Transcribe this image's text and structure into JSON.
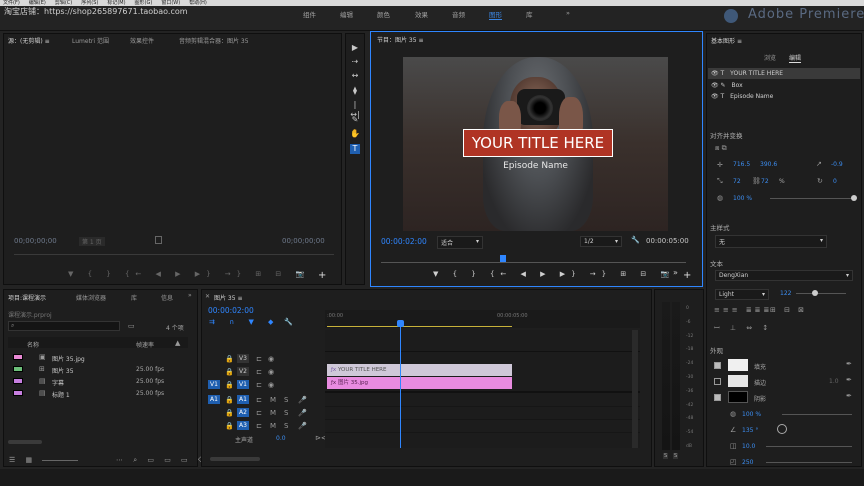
{
  "menu": [
    "文件(F)",
    "编辑(E)",
    "剪辑(C)",
    "序列(S)",
    "标记(M)",
    "图形(G)",
    "窗口(W)",
    "帮助(H)"
  ],
  "shop_label": "淘宝店铺：https://shop265897671.taobao.com",
  "workspaces": [
    "组件",
    "编辑",
    "颜色",
    "效果",
    "音频",
    "图形",
    "库"
  ],
  "workspace_more": "»",
  "brand": "Adobe Premiere",
  "source_panel": {
    "tabs": [
      "源：(无剪辑)",
      "Lumetri 范围",
      "效果控件",
      "音频剪辑混合器：图片 35"
    ],
    "menu_glyph": "≡",
    "tc_left": "00;00;00;00",
    "page_label": "第 1 页",
    "tc_right": "00;00;00;00",
    "controls": "▼ { } {← ◀ ▶ ▶} →} ⊞ ⊟ 📷",
    "add": "+"
  },
  "tools": [
    "▶",
    "⇢",
    "↔",
    "⧫",
    "|↔|",
    "✎",
    "✋",
    "T"
  ],
  "program_panel": {
    "title": "节目：图片 35",
    "menu_glyph": "≡",
    "title_overlay": "YOUR TITLE HERE",
    "episode": "Episode Name",
    "tc": "00:00:02:00",
    "fit": "适合",
    "quality": "1/2",
    "duration": "00:00:05:00",
    "wrench": "🔧",
    "controls": "▼ { } {← ◀ ▶ ▶} →} ⊞ ⊟ 📷",
    "more": "»",
    "add": "+"
  },
  "graphics_panel": {
    "title": "基本图形",
    "menu_glyph": "≡",
    "tab_browse": "浏览",
    "tab_edit": "编辑",
    "layers": [
      {
        "icon": "T",
        "name": "YOUR TITLE HERE"
      },
      {
        "icon": "✎",
        "name": "Box"
      },
      {
        "icon": "T",
        "name": "Episode Name"
      }
    ],
    "align_label": "对齐并变换",
    "pos_x": "716.5",
    "pos_y": "390.6",
    "rotation": "-0.9",
    "scale_w": "72",
    "scale_h": "72",
    "scale_unit": "%",
    "rot_val": "0",
    "opacity": "100 %",
    "master_style_label": "主样式",
    "master_style_value": "无",
    "text_label": "文本",
    "font": "DengXian",
    "weight": "Light",
    "size": "122",
    "appearance_label": "外观",
    "fill_label": "填充",
    "stroke_label": "描边",
    "stroke_width": "1.0",
    "shadow_label": "阴影",
    "shadow_opacity": "100 %",
    "shadow_angle": "135 °",
    "shadow_distance": "10.0",
    "shadow_size": "250",
    "fill_color": "#f0f0f0",
    "stroke_color": "#e6e6e6",
    "shadow_color": "#000000"
  },
  "project_panel": {
    "tabs": [
      "项目:课程演示",
      "媒体浏览器",
      "库",
      "信息"
    ],
    "more": "»",
    "file": "课程演示.prproj",
    "count": "4 个项",
    "col_name": "名称",
    "col_rate": "帧速率",
    "items": [
      {
        "color": "#e889d4",
        "icon": "▣",
        "name": "图片 35.jpg",
        "rate": ""
      },
      {
        "color": "#6dc07a",
        "icon": "⊞",
        "name": "图片 35",
        "rate": "25.00 fps"
      },
      {
        "color": "#c77fe0",
        "icon": "▤",
        "name": "字幕",
        "rate": "25.00 fps"
      },
      {
        "color": "#c77fe0",
        "icon": "▤",
        "name": "标题 1",
        "rate": "25.00 fps"
      }
    ]
  },
  "timeline": {
    "tab": "图片 35",
    "menu_glyph": "≡",
    "tc": "00:00:02:00",
    "ruler_start": ":00:00",
    "ruler_mid": "00:00:05:00",
    "tracks_video": [
      "V3",
      "V2",
      "V1"
    ],
    "tracks_audio": [
      "A1",
      "A2",
      "A3"
    ],
    "master_label": "主声道",
    "master_value": "0.0",
    "source_v1": "V1",
    "source_a1": "A1",
    "clip_title": "YOUR TITLE HERE",
    "clip_image": "图片 35.jpg",
    "meter_labels": [
      "S",
      "S"
    ],
    "meter_db": [
      "0",
      "-6",
      "-12",
      "-18",
      "-24",
      "-30",
      "-36",
      "-42",
      "-48",
      "-54",
      "dB"
    ]
  }
}
